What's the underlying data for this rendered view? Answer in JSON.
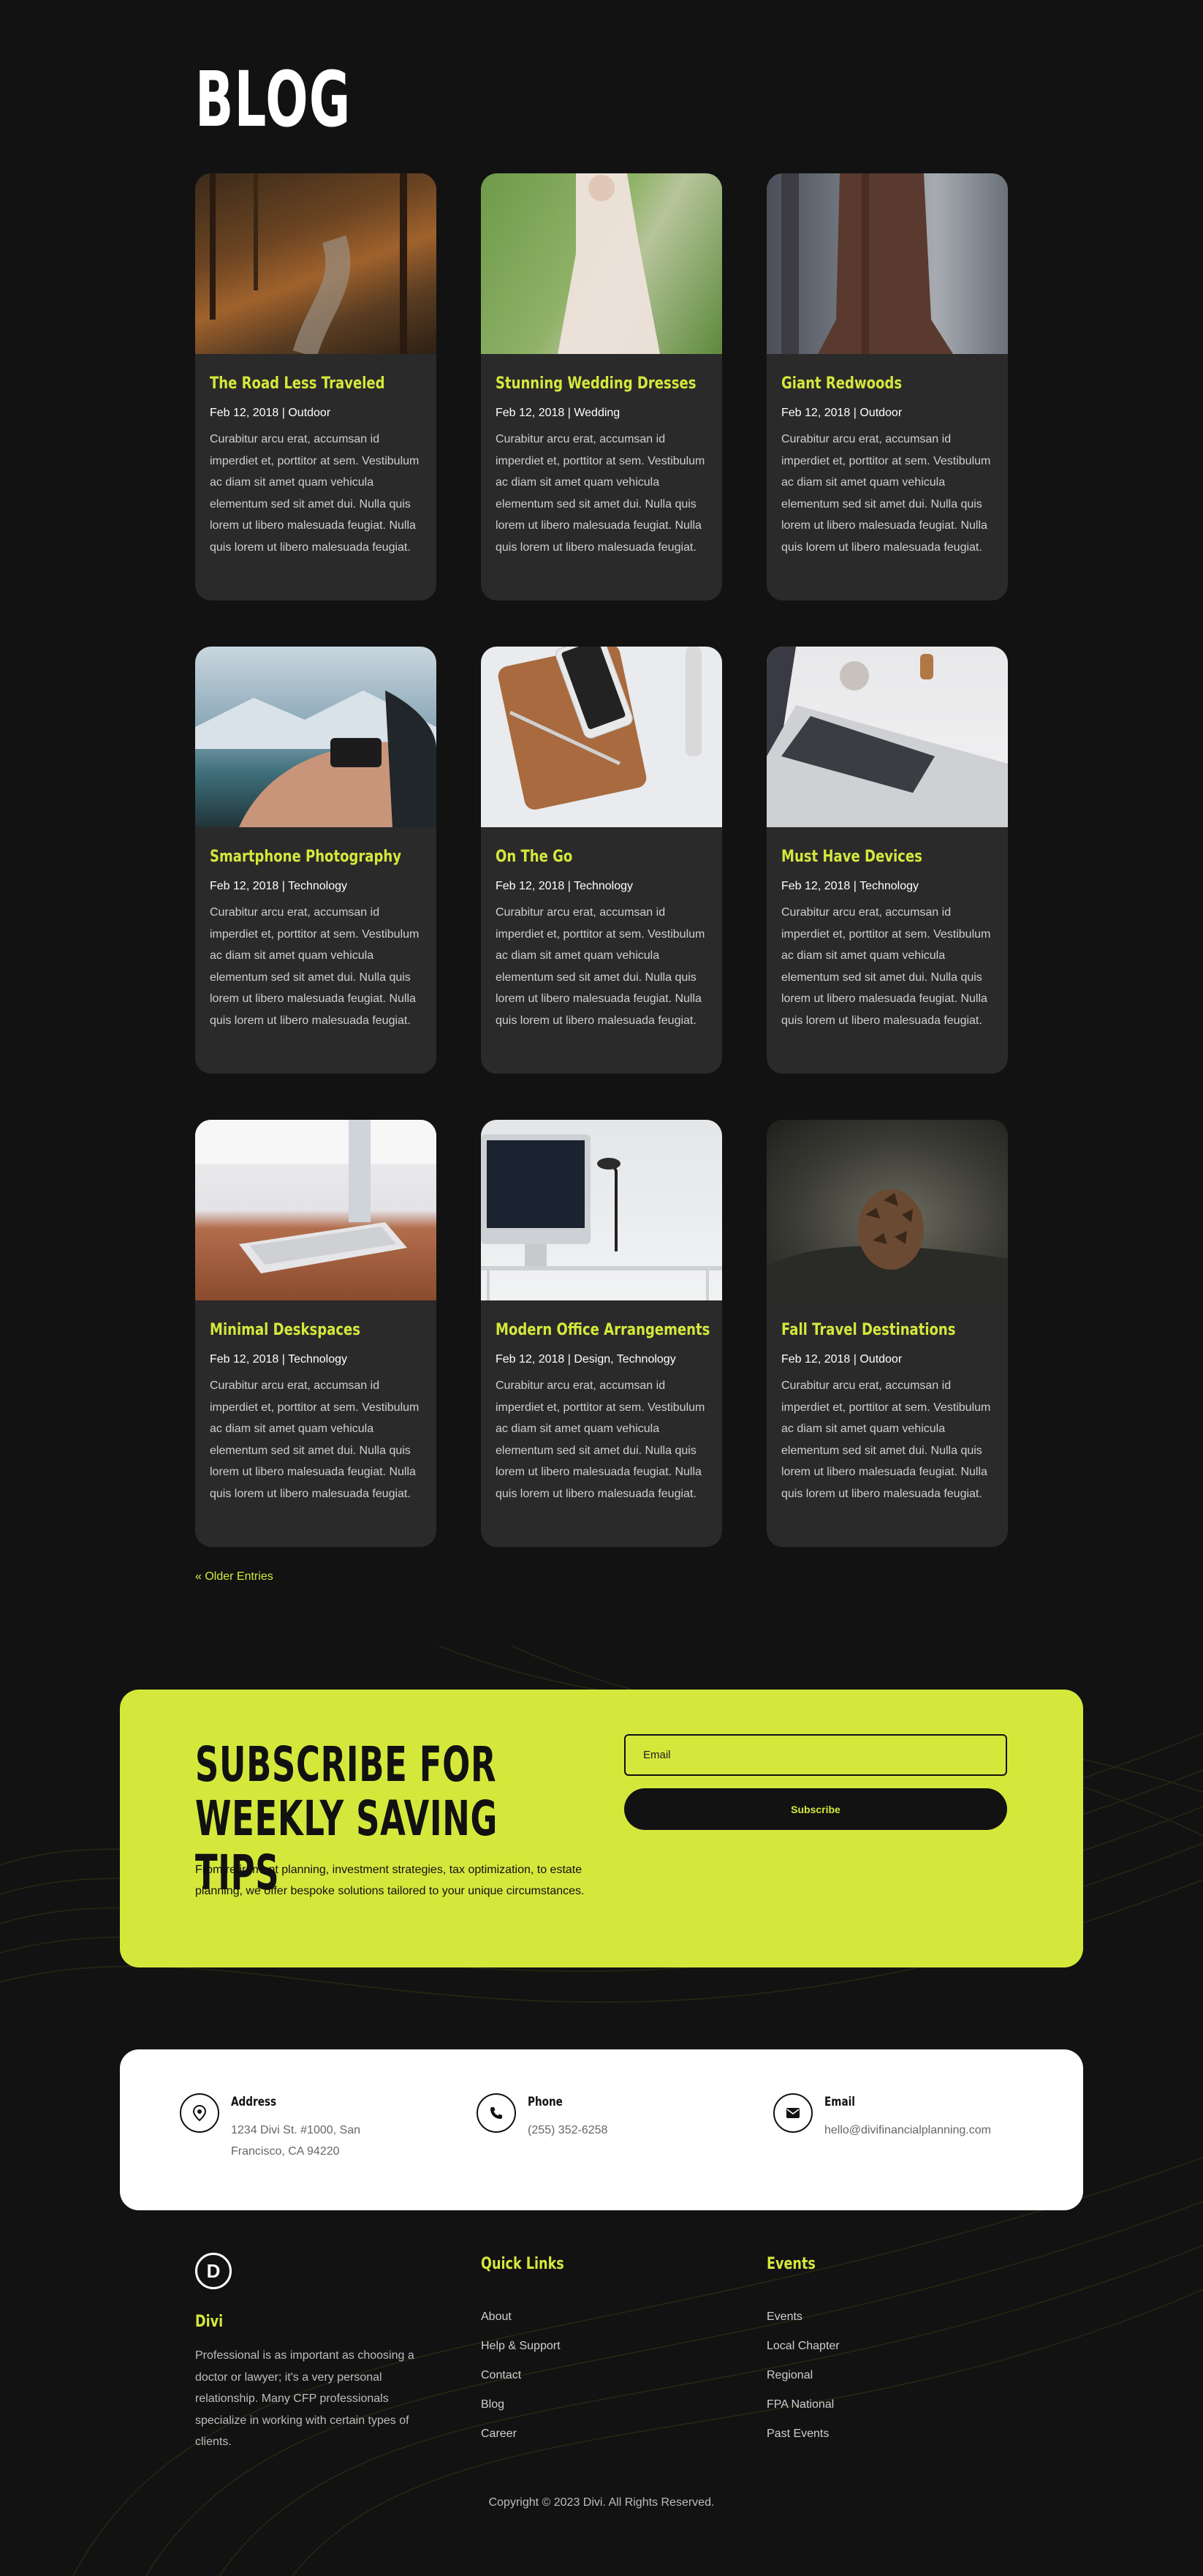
{
  "page": {
    "title": "BLOG"
  },
  "posts": [
    {
      "title": "The Road Less Traveled",
      "date": "Feb 12, 2018",
      "category": "Outdoor",
      "excerpt": "Curabitur arcu erat, accumsan id imperdiet et, porttitor at sem. Vestibulum ac diam sit amet quam vehicula elementum sed sit amet dui. Nulla quis lorem ut libero malesuada feugiat. Nulla quis lorem ut libero malesuada feugiat.",
      "image": "forest-path-photo"
    },
    {
      "title": "Stunning Wedding Dresses",
      "date": "Feb 12, 2018",
      "category": "Wedding",
      "excerpt": "Curabitur arcu erat, accumsan id imperdiet et, porttitor at sem. Vestibulum ac diam sit amet quam vehicula elementum sed sit amet dui. Nulla quis lorem ut libero malesuada feugiat. Nulla quis lorem ut libero malesuada feugiat.",
      "image": "wedding-dress-photo"
    },
    {
      "title": "Giant Redwoods",
      "date": "Feb 12, 2018",
      "category": "Outdoor",
      "excerpt": "Curabitur arcu erat, accumsan id imperdiet et, porttitor at sem. Vestibulum ac diam sit amet quam vehicula elementum sed sit amet dui. Nulla quis lorem ut libero malesuada feugiat. Nulla quis lorem ut libero malesuada feugiat.",
      "image": "redwood-tree-photo"
    },
    {
      "title": "Smartphone Photography",
      "date": "Feb 12, 2018",
      "category": "Technology",
      "excerpt": "Curabitur arcu erat, accumsan id imperdiet et, porttitor at sem. Vestibulum ac diam sit amet quam vehicula elementum sed sit amet dui. Nulla quis lorem ut libero malesuada feugiat. Nulla quis lorem ut libero malesuada feugiat.",
      "image": "smartphone-photo"
    },
    {
      "title": "On The Go",
      "date": "Feb 12, 2018",
      "category": "Technology",
      "excerpt": "Curabitur arcu erat, accumsan id imperdiet et, porttitor at sem. Vestibulum ac diam sit amet quam vehicula elementum sed sit amet dui. Nulla quis lorem ut libero malesuada feugiat. Nulla quis lorem ut libero malesuada feugiat.",
      "image": "tablet-phone-photo"
    },
    {
      "title": "Must Have Devices",
      "date": "Feb 12, 2018",
      "category": "Technology",
      "excerpt": "Curabitur arcu erat, accumsan id imperdiet et, porttitor at sem. Vestibulum ac diam sit amet quam vehicula elementum sed sit amet dui. Nulla quis lorem ut libero malesuada feugiat. Nulla quis lorem ut libero malesuada feugiat.",
      "image": "laptop-photo"
    },
    {
      "title": "Minimal Deskspaces",
      "date": "Feb 12, 2018",
      "category": "Technology",
      "excerpt": "Curabitur arcu erat, accumsan id imperdiet et, porttitor at sem. Vestibulum ac diam sit amet quam vehicula elementum sed sit amet dui. Nulla quis lorem ut libero malesuada feugiat. Nulla quis lorem ut libero malesuada feugiat.",
      "image": "keyboard-photo"
    },
    {
      "title": "Modern Office Arrangements",
      "date": "Feb 12, 2018",
      "category": "Design, Technology",
      "excerpt": "Curabitur arcu erat, accumsan id imperdiet et, porttitor at sem. Vestibulum ac diam sit amet quam vehicula elementum sed sit amet dui. Nulla quis lorem ut libero malesuada feugiat. Nulla quis lorem ut libero malesuada feugiat.",
      "image": "office-desk-photo"
    },
    {
      "title": "Fall Travel Destinations",
      "date": "Feb 12, 2018",
      "category": "Outdoor",
      "excerpt": "Curabitur arcu erat, accumsan id imperdiet et, porttitor at sem. Vestibulum ac diam sit amet quam vehicula elementum sed sit amet dui. Nulla quis lorem ut libero malesuada feugiat. Nulla quis lorem ut libero malesuada feugiat.",
      "image": "pinecone-photo"
    }
  ],
  "pagination": {
    "older_label": "« Older Entries"
  },
  "subscribe": {
    "heading": "SUBSCRIBE FOR WEEKLY SAVING TIPS",
    "text": "From retirement planning, investment strategies, tax optimization, to estate planning, we offer bespoke solutions tailored to your unique circumstances.",
    "email_placeholder": "Email",
    "button_label": "Subscribe"
  },
  "contact": {
    "address": {
      "label": "Address",
      "value_line1": "1234 Divi St. #1000, San",
      "value_line2": "Francisco, CA 94220",
      "icon": "location-pin-icon"
    },
    "phone": {
      "label": "Phone",
      "value": "(255) 352-6258",
      "icon": "phone-icon"
    },
    "email": {
      "label": "Email",
      "value": "hello@divifinancialplanning.com",
      "icon": "envelope-icon"
    }
  },
  "footer": {
    "logo_letter": "D",
    "brand": "Divi",
    "about": "Professional is as important as choosing a doctor or lawyer; it's a very personal relationship. Many CFP professionals specialize in working with certain types of clients.",
    "quick_links_title": "Quick Links",
    "quick_links": [
      "About",
      "Help & Support",
      "Contact",
      "Blog",
      "Career"
    ],
    "events_title": "Events",
    "events": [
      "Events",
      "Local Chapter",
      "Regional",
      "FPA National",
      "Past Events"
    ],
    "copyright": "Copyright © 2023 Divi. All Rights Reserved."
  },
  "colors": {
    "accent": "#d4e83c",
    "background": "#121212",
    "card": "#2a2a2a"
  }
}
